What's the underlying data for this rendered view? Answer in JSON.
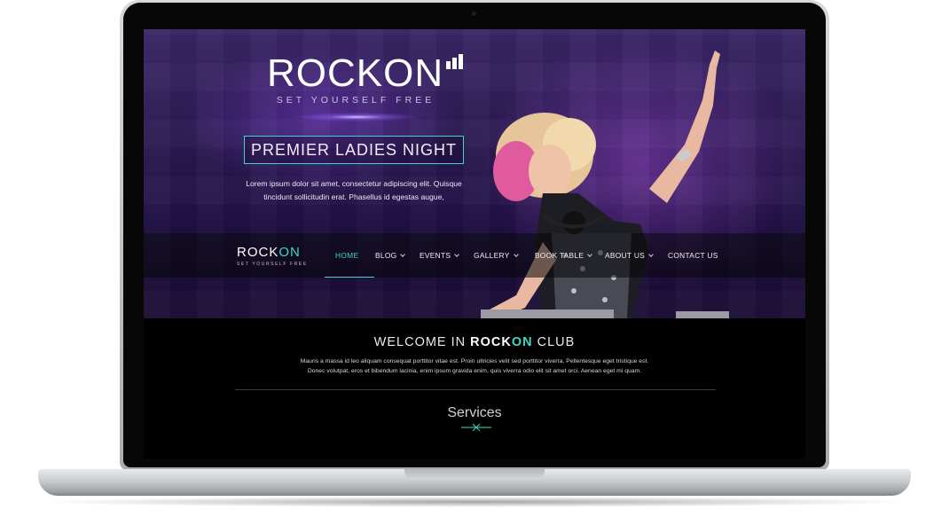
{
  "hero": {
    "logo": "ROCKON",
    "tagline": "SET YOURSELF FREE",
    "promo_title": "PREMIER LADIES NIGHT",
    "promo_text_line1": "Lorem ipsum dolor sit amet, consectetur adipiscing elit. Quisque",
    "promo_text_line2": "tincidunt sollicitudin erat. Phasellus id egestas augue,"
  },
  "nav": {
    "logo_main": "ROCK",
    "logo_accent": "ON",
    "logo_tagline": "SET YOURSELF FREE",
    "items": [
      {
        "label": "HOME",
        "active": true,
        "dropdown": false
      },
      {
        "label": "BLOG",
        "active": false,
        "dropdown": true
      },
      {
        "label": "EVENTS",
        "active": false,
        "dropdown": true
      },
      {
        "label": "GALLERY",
        "active": false,
        "dropdown": true
      },
      {
        "label": "BOOK TABLE",
        "active": false,
        "dropdown": true
      },
      {
        "label": "ABOUT US",
        "active": false,
        "dropdown": true
      },
      {
        "label": "CONTACT US",
        "active": false,
        "dropdown": false
      }
    ]
  },
  "welcome": {
    "prefix": "WELCOME IN",
    "brand_main": "ROCK",
    "brand_accent": "ON",
    "suffix": "CLUB",
    "text_line1": "Mauris a massa id leo aliquam consequat porttitor vitae est. Proin ultricies velit sed porttitor viverra. Pellentesque eget tristique est.",
    "text_line2": "Donec volutpat, eros et bibendum lacinia, enim ipsum gravida enim, quis viverra odio elit sit amet orci. Aenean eget mi quam."
  },
  "services": {
    "title": "Services"
  },
  "colors": {
    "accent": "#3fd6c4",
    "hero_purple": "#2b1a52",
    "page_bg": "#000000"
  }
}
